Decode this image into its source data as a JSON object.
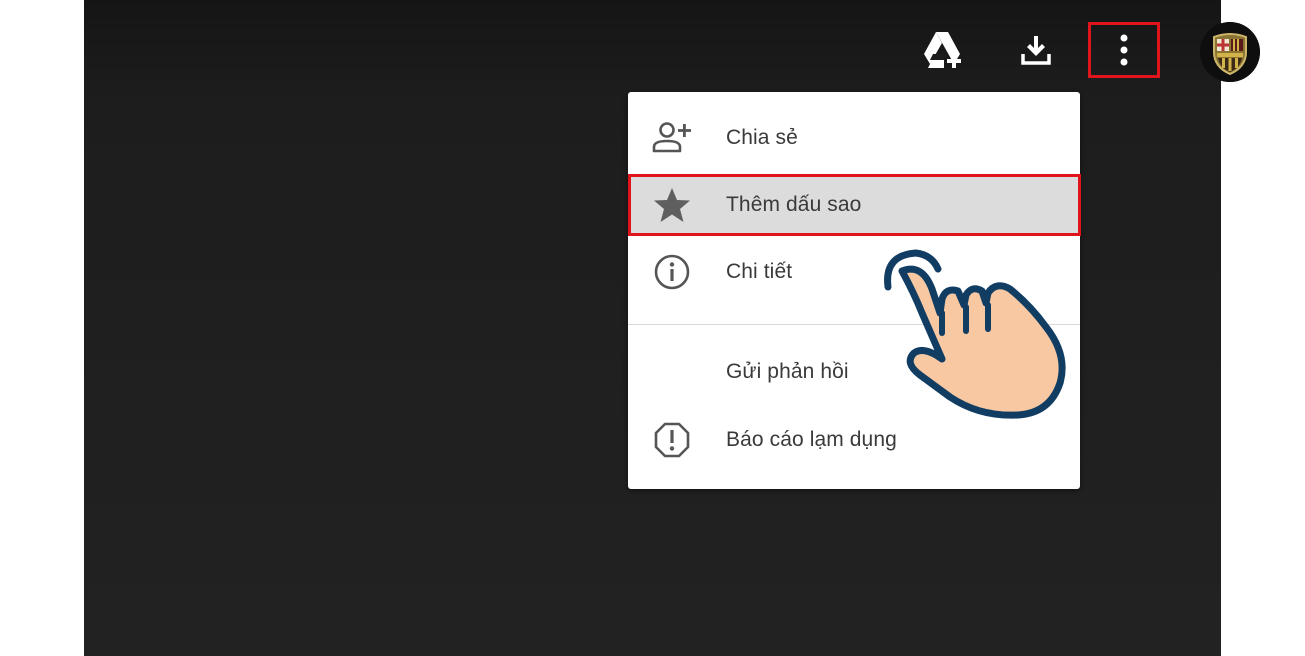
{
  "toolbar": {
    "add_to_drive_icon": "google-drive-add-icon",
    "download_icon": "download-icon",
    "more_icon": "more-vert-icon",
    "highlight_color": "#e0151b"
  },
  "avatar": {
    "icon": "fc-barcelona-crest-avatar"
  },
  "menu": {
    "items": [
      {
        "label": "Chia sẻ",
        "icon": "person-add-icon"
      },
      {
        "label": "Thêm dấu sao",
        "icon": "star-icon",
        "highlighted": true
      },
      {
        "label": "Chi tiết",
        "icon": "info-icon"
      },
      {
        "label": "Gửi phản hồi",
        "icon": ""
      },
      {
        "label": "Báo cáo lạm dụng",
        "icon": "report-icon"
      }
    ]
  },
  "overlay": {
    "icon": "pointing-hand-cursor-icon"
  }
}
